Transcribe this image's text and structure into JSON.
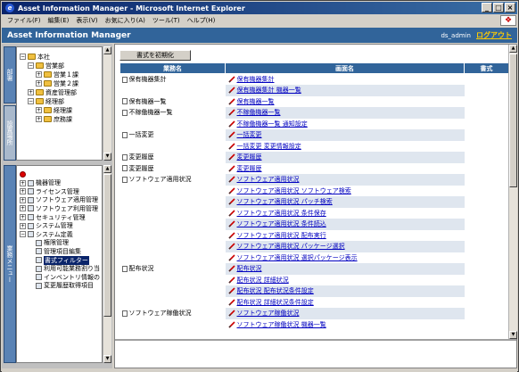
{
  "window": {
    "title": "Asset Information Manager - Microsoft Internet Explorer",
    "min_label": "_",
    "max_label": "□",
    "close_label": "×"
  },
  "menubar": [
    "ファイル(F)",
    "編集(E)",
    "表示(V)",
    "お気に入り(A)",
    "ツール(T)",
    "ヘルプ(H)"
  ],
  "app": {
    "title": "Asset Information Manager",
    "user": "ds_admin",
    "logout": "ログアウト"
  },
  "left": {
    "tab_top": "部署",
    "tab_top2": "設置場所",
    "tab_bottom": "業務メニュー",
    "tree1": [
      {
        "label": "本社",
        "indent": 0,
        "exp": "−"
      },
      {
        "label": "営業部",
        "indent": 1,
        "exp": "−"
      },
      {
        "label": "営業１課",
        "indent": 2,
        "exp": "+"
      },
      {
        "label": "営業２課",
        "indent": 2,
        "exp": "+"
      },
      {
        "label": "資産管理部",
        "indent": 1,
        "exp": "+"
      },
      {
        "label": "経理部",
        "indent": 1,
        "exp": "−"
      },
      {
        "label": "経理課",
        "indent": 2,
        "exp": "+"
      },
      {
        "label": "庶務課",
        "indent": 2,
        "exp": "+"
      }
    ],
    "tree2": [
      {
        "label": "",
        "indent": 0,
        "exp": "",
        "red": true
      },
      {
        "label": "機器管理",
        "indent": 0,
        "exp": "+"
      },
      {
        "label": "ライセンス管理",
        "indent": 0,
        "exp": "+"
      },
      {
        "label": "ソフトウェア適用管理",
        "indent": 0,
        "exp": "+"
      },
      {
        "label": "ソフトウェア利用管理",
        "indent": 0,
        "exp": "+"
      },
      {
        "label": "セキュリティ管理",
        "indent": 0,
        "exp": "+"
      },
      {
        "label": "システム管理",
        "indent": 0,
        "exp": "+"
      },
      {
        "label": "システム定義",
        "indent": 0,
        "exp": "−"
      },
      {
        "label": "権限管理",
        "indent": 1,
        "exp": ""
      },
      {
        "label": "管理項目編集",
        "indent": 1,
        "exp": ""
      },
      {
        "label": "書式フィルター",
        "indent": 1,
        "exp": "",
        "selected": true
      },
      {
        "label": "利用可能業務割り当",
        "indent": 1,
        "exp": ""
      },
      {
        "label": "インベントリ情報の",
        "indent": 1,
        "exp": ""
      },
      {
        "label": "変更履歴取得項目",
        "indent": 1,
        "exp": ""
      }
    ]
  },
  "main": {
    "reset_button": "書式を初期化",
    "headers": [
      "業務名",
      "画面名",
      "書式"
    ],
    "rows": [
      {
        "task": "保有機器集計",
        "screen": "保有機器集計"
      },
      {
        "task": "",
        "screen": "保有機器集計 機器一覧"
      },
      {
        "task": "保有機器一覧",
        "screen": "保有機器一覧"
      },
      {
        "task": "不稼働機器一覧",
        "screen": "不稼働機器一覧"
      },
      {
        "task": "",
        "screen": "不稼働機器一覧 通知設定"
      },
      {
        "task": "一括変更",
        "screen": "一括変更"
      },
      {
        "task": "",
        "screen": "一括変更 変更情報設定"
      },
      {
        "task": "変更履歴",
        "screen": "変更履歴"
      },
      {
        "task": "変更履歴",
        "screen": "変更履歴"
      },
      {
        "task": "ソフトウェア適用状況",
        "screen": "ソフトウェア適用状況"
      },
      {
        "task": "",
        "screen": "ソフトウェア適用状況 ソフトウェア検索"
      },
      {
        "task": "",
        "screen": "ソフトウェア適用状況 パッチ検索"
      },
      {
        "task": "",
        "screen": "ソフトウェア適用状況 条件保存"
      },
      {
        "task": "",
        "screen": "ソフトウェア適用状況 条件読込"
      },
      {
        "task": "",
        "screen": "ソフトウェア適用状況 配布実行"
      },
      {
        "task": "",
        "screen": "ソフトウェア適用状況 パッケージ選択"
      },
      {
        "task": "",
        "screen": "ソフトウェア適用状況 選択パッケージ表示"
      },
      {
        "task": "配布状況",
        "screen": "配布状況"
      },
      {
        "task": "",
        "screen": "配布状況 詳細状況"
      },
      {
        "task": "",
        "screen": "配布状況 配布状況条件設定"
      },
      {
        "task": "",
        "screen": "配布状況 詳細状況条件設定"
      },
      {
        "task": "ソフトウェア稼働状況",
        "screen": "ソフトウェア稼働状況"
      },
      {
        "task": "",
        "screen": "ソフトウェア稼働状況 機器一覧"
      }
    ]
  }
}
